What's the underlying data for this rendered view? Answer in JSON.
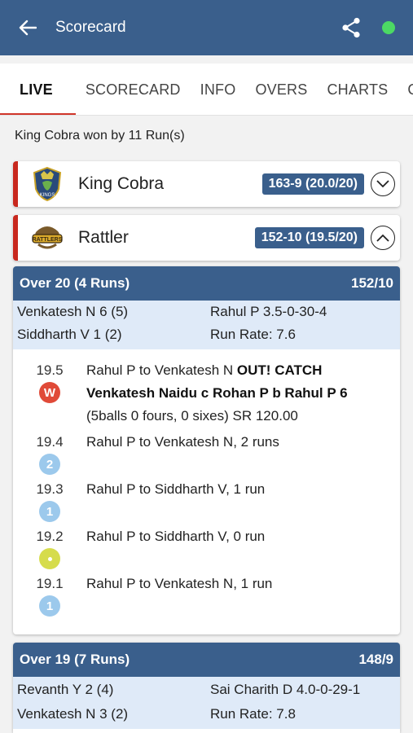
{
  "header": {
    "title": "Scorecard"
  },
  "tabs": [
    "LIVE",
    "SCORECARD",
    "INFO",
    "OVERS",
    "CHARTS",
    "GALLERY"
  ],
  "result": "King Cobra won by 11 Run(s)",
  "teams": [
    {
      "name": "King Cobra",
      "score": "163-9 (20.0/20)",
      "logo_text": "KINGS"
    },
    {
      "name": "Rattler",
      "score": "152-10 (19.5/20)",
      "logo_text": "RATTLERS"
    }
  ],
  "overs": [
    {
      "title": "Over 20 (4 Runs)",
      "total": "152/10",
      "batter1": "Venkatesh N 6 (5)",
      "bowler": "Rahul P 3.5-0-30-4",
      "batter2": "Siddharth V 1 (2)",
      "run_rate": "Run Rate: 7.6",
      "balls": [
        {
          "num": "19.5",
          "badge": "W",
          "type": "w",
          "text": "Rahul P to Venkatesh N ",
          "bold": "OUT! CATCH Venkatesh Naidu c Rohan P b Rahul P 6",
          "rest": " (5balls 0 fours, 0 sixes) SR 120.00"
        },
        {
          "num": "19.4",
          "badge": "2",
          "type": "r",
          "text": "Rahul P to Venkatesh N, 2 runs"
        },
        {
          "num": "19.3",
          "badge": "1",
          "type": "r",
          "text": "Rahul P to Siddharth V, 1 run"
        },
        {
          "num": "19.2",
          "badge": "",
          "type": "dot",
          "text": "Rahul P to Siddharth V, 0 run"
        },
        {
          "num": "19.1",
          "badge": "1",
          "type": "r",
          "text": "Rahul P to Venkatesh N, 1 run"
        }
      ]
    },
    {
      "title": "Over 19 (7 Runs)",
      "total": "148/9",
      "batter1": "Revanth Y 2 (4)",
      "bowler": "Sai Charith D 4.0-0-29-1",
      "batter2": "Venkatesh N 3 (2)",
      "run_rate": "Run Rate: 7.8"
    }
  ]
}
